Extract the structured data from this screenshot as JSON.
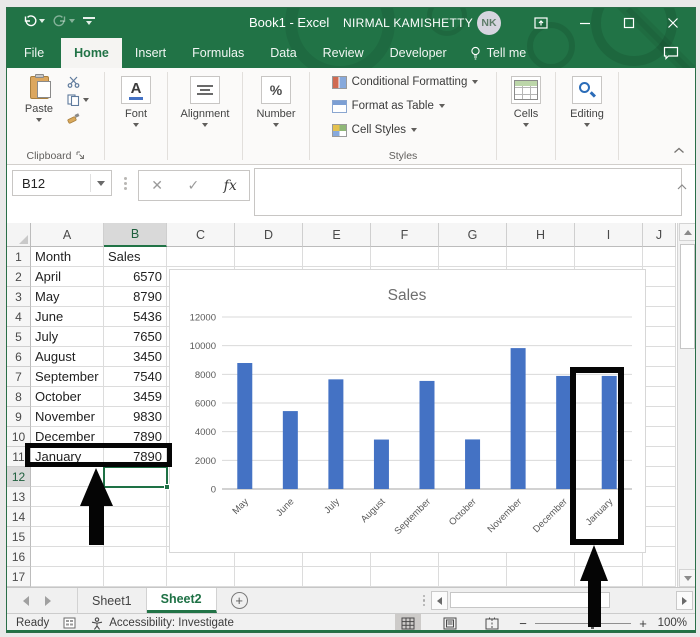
{
  "title_bar": {
    "title": "Book1 - Excel",
    "user_name": "NIRMAL KAMISHETTY",
    "avatar_initials": "NK"
  },
  "ribbon_tabs": [
    "File",
    "Home",
    "Insert",
    "Formulas",
    "Data",
    "Review",
    "Developer",
    "Tell me"
  ],
  "active_ribbon_tab": "Home",
  "ribbon": {
    "paste_label": "Paste",
    "clipboard_group_label": "Clipboard",
    "font_label": "Font",
    "alignment_label": "Alignment",
    "number_label": "Number",
    "styles": {
      "items": [
        "Conditional Formatting",
        "Format as Table",
        "Cell Styles"
      ],
      "group_label": "Styles"
    },
    "cells_label": "Cells",
    "editing_label": "Editing"
  },
  "formula_bar": {
    "name_box": "B12",
    "fx_label": "fx",
    "formula_value": ""
  },
  "sheet": {
    "columns": [
      "A",
      "B",
      "C",
      "D",
      "E",
      "F",
      "G",
      "H",
      "I",
      "J"
    ],
    "row_numbers": [
      "1",
      "2",
      "3",
      "4",
      "5",
      "6",
      "7",
      "8",
      "9",
      "10",
      "11",
      "12",
      "13",
      "14",
      "15",
      "16",
      "17"
    ],
    "selected_column": "B",
    "selected_row": "12",
    "selected_cell": "B12",
    "table": [
      [
        "Month",
        "Sales"
      ],
      [
        "April",
        "6570"
      ],
      [
        "May",
        "8790"
      ],
      [
        "June",
        "5436"
      ],
      [
        "July",
        "7650"
      ],
      [
        "August",
        "3450"
      ],
      [
        "September",
        "7540"
      ],
      [
        "October",
        "3459"
      ],
      [
        "November",
        "9830"
      ],
      [
        "December",
        "7890"
      ],
      [
        "January",
        "7890"
      ]
    ]
  },
  "chart_data": {
    "type": "bar",
    "title": "Sales",
    "categories": [
      "May",
      "June",
      "July",
      "August",
      "September",
      "October",
      "November",
      "December",
      "January"
    ],
    "values": [
      8790,
      5436,
      7650,
      3450,
      7540,
      3459,
      9830,
      7890,
      7890
    ],
    "yticks": [
      0,
      2000,
      4000,
      6000,
      8000,
      10000,
      12000
    ],
    "ylim": [
      0,
      12000
    ],
    "xlabel": "",
    "ylabel": "",
    "grid": true,
    "legend": false,
    "bar_color": "#4472C4",
    "highlighted_category": "January"
  },
  "annotations": {
    "highlighted_cell_range": "A11:B11",
    "highlighted_chart_category": "January",
    "annotation_color": "#000000"
  },
  "sheet_tabs": {
    "names": [
      "Sheet1",
      "Sheet2"
    ],
    "active": "Sheet2"
  },
  "status_bar": {
    "ready": "Ready",
    "accessibility": "Accessibility: Investigate",
    "zoom_level": "100%"
  },
  "colors": {
    "excel_green": "#217346",
    "bar_blue": "#4472C4",
    "selection_green": "#1E7145",
    "annotation_black": "#000000"
  }
}
